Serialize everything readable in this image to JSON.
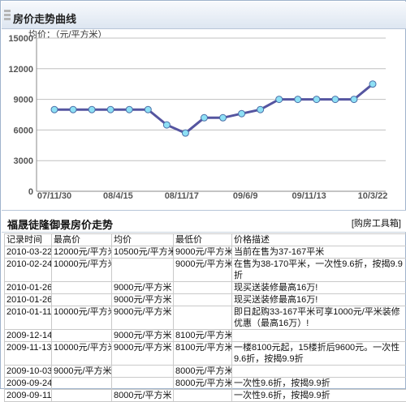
{
  "header": {
    "title": "房价走势曲线"
  },
  "chart": {
    "unit_label": "均价：（元/平方米）"
  },
  "chart_data": {
    "type": "line",
    "ylim": [
      0,
      15000
    ],
    "yticks": [
      "0",
      "3000",
      "6000",
      "9000",
      "12000",
      "15000"
    ],
    "xticks": [
      "07/11/30",
      "08/4/15",
      "08/11/17",
      "09/6/9",
      "09/11/13",
      "10/3/22"
    ],
    "values": [
      8000,
      8000,
      8000,
      8000,
      8000,
      8000,
      6500,
      5700,
      7200,
      7200,
      7600,
      8000,
      9000,
      9000,
      9000,
      9000,
      9000,
      10500
    ],
    "grid": "horizontal",
    "colors": {
      "line": "#5555a0",
      "marker": "#8ee0f5",
      "grid": "#c0c0c0"
    }
  },
  "table": {
    "title": "福晟徒隆御景房价走势",
    "tool": "[购房工具箱]",
    "columns": [
      "记录时间",
      "最高价",
      "均价",
      "最低价",
      "价格描述"
    ],
    "rows": [
      [
        "2010-03-22",
        "12000元/平方米",
        "10500元/平方米",
        "9000元/平方米",
        "当前在售为37-167平米"
      ],
      [
        "2010-02-24",
        "10000元/平方米",
        "",
        "9000元/平方米",
        "在售为38-170平米，一次性9.6折，按揭9.9折"
      ],
      [
        "2010-01-26",
        "",
        "9000元/平方米",
        "",
        "现买送装修最高16万!"
      ],
      [
        "2010-01-26",
        "",
        "9000元/平方米",
        "",
        "现买送装修最高16万!"
      ],
      [
        "2010-01-11",
        "10000元/平方米",
        "9000元/平方米",
        "",
        "即日起购33-167平米可享1000元/平米装修优惠（最高16万）!"
      ],
      [
        "2009-12-14",
        "",
        "9000元/平方米",
        "8100元/平方米",
        ""
      ],
      [
        "2009-11-13",
        "10000元/平方米",
        "9000元/平方米",
        "8100元/平方米",
        "一楼8100元起，15楼折后9600元。一次性9.6折，按揭9.9折"
      ],
      [
        "2009-10-03",
        "9000元/平方米",
        "",
        "8000元/平方米",
        ""
      ],
      [
        "2009-09-24",
        "",
        "",
        "8000元/平方米",
        "一次性9.6折，按揭9.9折"
      ],
      [
        "2009-09-11",
        "",
        "8000元/平方米",
        "",
        "一次性9.6折，按揭9.9折"
      ]
    ]
  }
}
